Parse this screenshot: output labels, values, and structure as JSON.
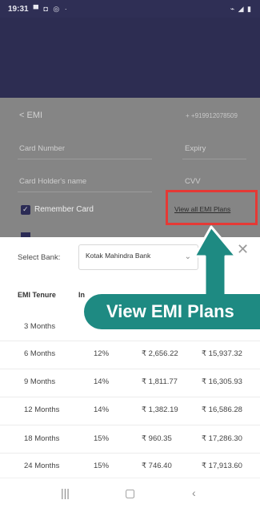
{
  "status_bar": {
    "time": "19:31",
    "icons_left": "▀ ◘ ◎ ·",
    "icons_right": "⌁ ◢ ▮"
  },
  "header": {
    "back_label": "< EMI",
    "phone": "+ +919912078509"
  },
  "form": {
    "card_number_label": "Card Number",
    "expiry_label": "Expiry",
    "card_holder_label": "Card Holder's name",
    "cvv_label": "CVV",
    "remember_card_label": "Remember Card",
    "view_emi_link": "View all EMI Plans"
  },
  "sheet": {
    "select_bank_label": "Select Bank:",
    "selected_bank": "Kotak Mahindra Bank",
    "close_glyph": "✕",
    "columns": {
      "tenure": "EMI Tenure",
      "interest_partial": "In"
    },
    "rows": [
      {
        "tenure": "3 Months",
        "rate": "",
        "emi": "",
        "total": ""
      },
      {
        "tenure": "6 Months",
        "rate": "12%",
        "emi": "₹ 2,656.22",
        "total": "₹ 15,937.32"
      },
      {
        "tenure": "9 Months",
        "rate": "14%",
        "emi": "₹ 1,811.77",
        "total": "₹ 16,305.93"
      },
      {
        "tenure": "12 Months",
        "rate": "14%",
        "emi": "₹ 1,382.19",
        "total": "₹ 16,586.28"
      },
      {
        "tenure": "18 Months",
        "rate": "15%",
        "emi": "₹ 960.35",
        "total": "₹ 17,286.30"
      },
      {
        "tenure": "24 Months",
        "rate": "15%",
        "emi": "₹ 746.40",
        "total": "₹ 17,913.60"
      }
    ]
  },
  "callout": {
    "label": "View EMI Plans"
  },
  "nav": {
    "recent": "|||",
    "home": "▢",
    "back": "‹"
  },
  "colors": {
    "accent_teal": "#1e8a82",
    "highlight_red": "#e53935",
    "header_navy": "#2d2d52"
  }
}
